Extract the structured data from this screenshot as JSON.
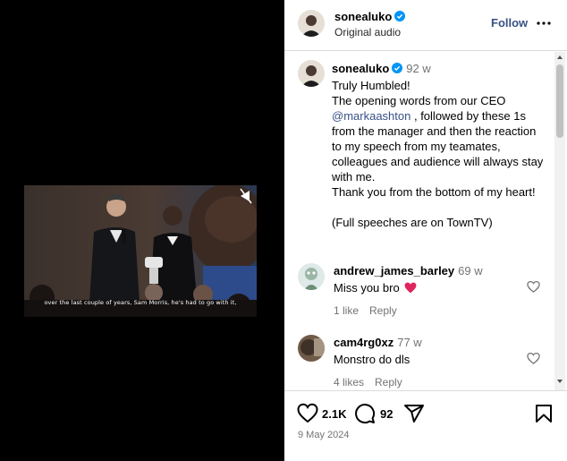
{
  "post": {
    "username": "sonealuko",
    "audio": "Original audio",
    "follow_label": "Follow",
    "video_subtitle": "over the last couple of years, Sam Morris, he's had to go with it,"
  },
  "caption": {
    "username": "sonealuko",
    "time": "92 w",
    "line1": "Truly Humbled!",
    "line2_pre": "The opening words from our CEO ",
    "mention": "@markaashton",
    "line2_post": " , followed by these 1s from the manager and then the reaction to my speech from my teamates, colleagues and audience will always stay with me.",
    "line3": "Thank you from the bottom of my heart!",
    "line4": "(Full speeches are on TownTV)"
  },
  "comments": [
    {
      "username": "andrew_james_barley",
      "time": "69 w",
      "text": "Miss you bro",
      "likes": "1 like",
      "reply": "Reply",
      "emoji": "red-heart"
    },
    {
      "username": "cam4rg0xz",
      "time": "77 w",
      "text": "Monstro do dls",
      "likes": "4 likes",
      "reply": "Reply"
    }
  ],
  "actions": {
    "likes_count": "2.1K",
    "comments_count": "92",
    "date": "9 May 2024"
  },
  "icons": [
    "verified-badge-icon",
    "more-options-icon",
    "heart-icon",
    "comment-icon",
    "share-icon",
    "save-icon",
    "mute-icon"
  ],
  "colors": {
    "link": "#385185",
    "verified": "#0095f6",
    "muted_text": "#737373"
  }
}
